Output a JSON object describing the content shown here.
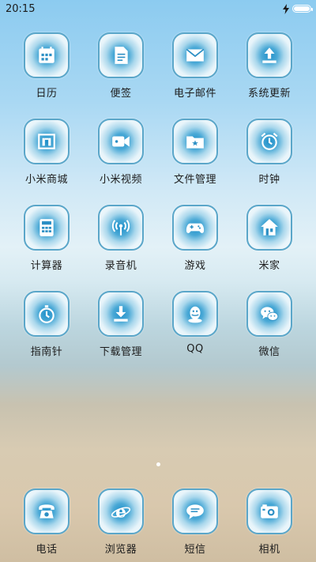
{
  "status_bar": {
    "time": "20:15"
  },
  "apps": [
    {
      "label": "日历",
      "icon": "calendar-icon"
    },
    {
      "label": "便签",
      "icon": "note-icon"
    },
    {
      "label": "电子邮件",
      "icon": "mail-icon"
    },
    {
      "label": "系统更新",
      "icon": "upload-icon"
    },
    {
      "label": "小米商城",
      "icon": "store-icon"
    },
    {
      "label": "小米视频",
      "icon": "video-camera-icon"
    },
    {
      "label": "文件管理",
      "icon": "folder-icon"
    },
    {
      "label": "时钟",
      "icon": "alarm-clock-icon"
    },
    {
      "label": "计算器",
      "icon": "calculator-icon"
    },
    {
      "label": "录音机",
      "icon": "antenna-icon"
    },
    {
      "label": "游戏",
      "icon": "gamepad-icon"
    },
    {
      "label": "米家",
      "icon": "home-icon"
    },
    {
      "label": "指南针",
      "icon": "stopwatch-icon"
    },
    {
      "label": "下载管理",
      "icon": "download-icon"
    },
    {
      "label": "QQ",
      "icon": "qq-penguin-icon"
    },
    {
      "label": "微信",
      "icon": "wechat-icon"
    }
  ],
  "dock": [
    {
      "label": "电话",
      "icon": "phone-icon"
    },
    {
      "label": "浏览器",
      "icon": "browser-icon"
    },
    {
      "label": "短信",
      "icon": "message-icon"
    },
    {
      "label": "相机",
      "icon": "camera-icon"
    }
  ]
}
